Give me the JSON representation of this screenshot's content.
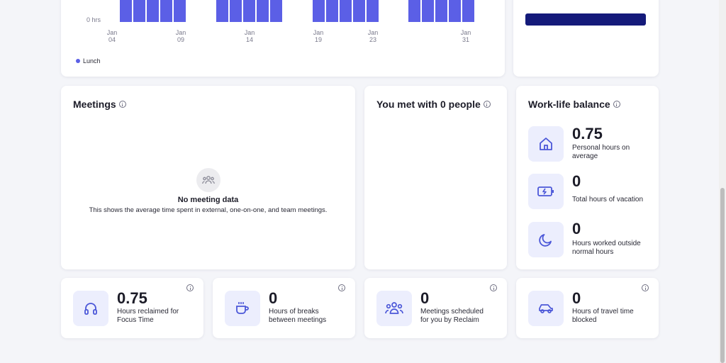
{
  "chart_data": {
    "type": "bar",
    "ytick": "0 hrs",
    "xticks": [
      {
        "top": "Jan",
        "bottom": "04"
      },
      {
        "top": "Jan",
        "bottom": "09"
      },
      {
        "top": "Jan",
        "bottom": "14"
      },
      {
        "top": "Jan",
        "bottom": "19"
      },
      {
        "top": "Jan",
        "bottom": "23"
      },
      {
        "top": "Jan",
        "bottom": "31"
      }
    ],
    "series": [
      {
        "name": "Lunch",
        "color": "#5b5fe6"
      }
    ]
  },
  "right_top": {
    "button_color": "#141a7a"
  },
  "meetings": {
    "title": "Meetings",
    "empty_title": "No meeting data",
    "empty_desc": "This shows the average time spent in external, one-on-one, and team meetings."
  },
  "met_with": {
    "title": "You met with 0 people"
  },
  "work_life": {
    "title": "Work-life balance",
    "items": [
      {
        "value": "0.75",
        "label_1": "Personal hours on",
        "label_2": "average",
        "icon": "home-icon"
      },
      {
        "value": "0",
        "label_1": "Total hours of vacation",
        "label_2": "",
        "icon": "battery-charging-icon"
      },
      {
        "value": "0",
        "label_1": "Hours worked outside",
        "label_2": "normal hours",
        "icon": "moon-icon"
      }
    ]
  },
  "stats": [
    {
      "value": "0.75",
      "label_1": "Hours reclaimed for",
      "label_2": "Focus Time",
      "icon": "headphones-icon"
    },
    {
      "value": "0",
      "label_1": "Hours of breaks",
      "label_2": "between meetings",
      "icon": "coffee-cup-icon"
    },
    {
      "value": "0",
      "label_1": "Meetings scheduled",
      "label_2": "for you by Reclaim",
      "icon": "people-group-icon"
    },
    {
      "value": "0",
      "label_1": "Hours of travel time",
      "label_2": "blocked",
      "icon": "car-icon"
    }
  ]
}
